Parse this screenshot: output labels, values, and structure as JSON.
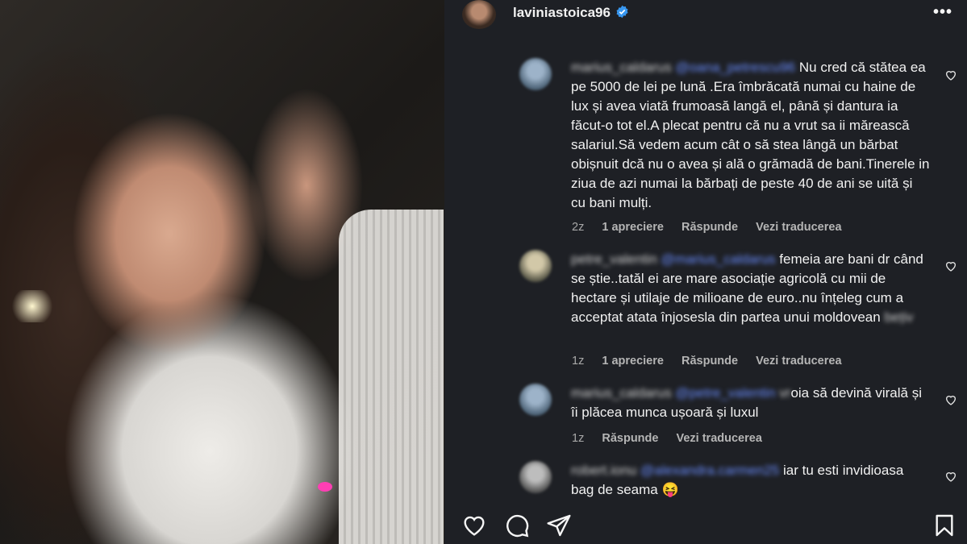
{
  "post": {
    "username": "laviniastoica96",
    "verified_icon": "verified-badge-icon",
    "more_icon": "more-options-icon",
    "more_label": "•••"
  },
  "comments": [
    {
      "user": "marius_caldarus",
      "mention": "@oana_petrescu96",
      "text": "Nu cred că stătea ea pe 5000 de lei pe lună .Era îmbrăcată numai cu haine de lux și avea viată frumoasă langă el, până și dantura ia făcut-o tot el.A plecat pentru că nu a vrut sa ii mărească salariul.Să vedem acum cât o să stea lângă un bărbat obișnuit dcă nu o avea și ală o grămadă de bani.Tinerele in ziua de azi numai la bărbați de peste 40 de ani se uită și cu bani mulți.",
      "time": "2z",
      "likes": "1 apreciere",
      "reply": "Răspunde",
      "translate": "Vezi traducerea"
    },
    {
      "user": "petre_valentin",
      "mention": "@marius_caldarus",
      "text_a": "femeia are bani dr când se știe..tatăl ei are mare asociație agricolă cu mii de hectare și utilaje de milioane de euro..nu înțeleg cum a acceptat atata înjosesla din partea unui moldovean ",
      "text_b": "bețiv",
      "time": "1z",
      "likes": "1 apreciere",
      "reply": "Răspunde",
      "translate": "Vezi traducerea"
    },
    {
      "user": "marius_caldarus",
      "mention": "@petre_valentin",
      "text_a": "vr",
      "text_b": "oia să devină virală și îi plăcea munca ușoară și luxul",
      "time": "1z",
      "reply": "Răspunde",
      "translate": "Vezi traducerea"
    },
    {
      "user": "robert.ionu",
      "mention": "@alexandra.carmen25",
      "text": "iar tu esti invidioasa bag de seama",
      "emoji": "😝"
    }
  ],
  "actions": {
    "like": "heart-icon",
    "comment": "comment-icon",
    "share": "share-icon",
    "save": "bookmark-icon"
  },
  "colors": {
    "panel_bg": "#1e2025",
    "verified": "#3897f0",
    "muted": "#a8a8a8"
  }
}
